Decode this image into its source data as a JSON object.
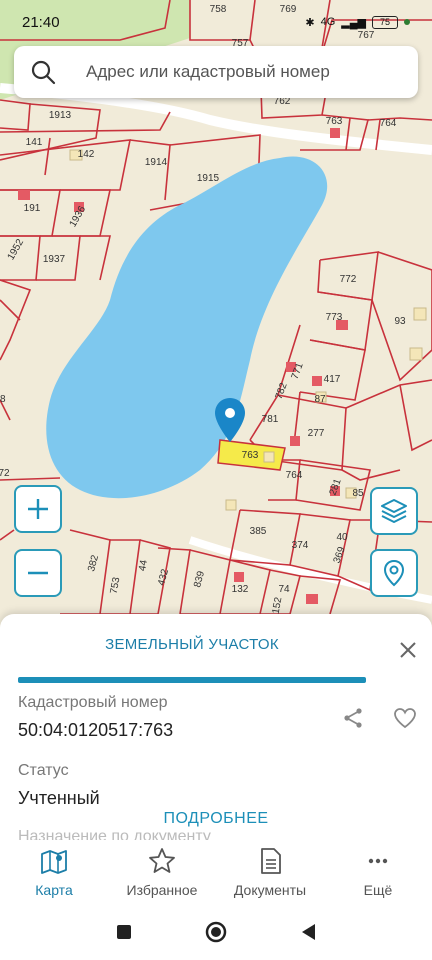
{
  "status_bar": {
    "time": "21:40",
    "network": "4G",
    "battery": "75"
  },
  "search": {
    "placeholder": "Адрес или кадастровый номер"
  },
  "map": {
    "plot_labels": [
      "758",
      "769",
      "757",
      "767",
      "762",
      "763",
      "764",
      "1913",
      "141",
      "142",
      "1914",
      "1915",
      "191",
      "1936",
      "1952",
      "1937",
      "772",
      "773",
      "93",
      "782",
      "771",
      "417",
      "87",
      "781",
      "277",
      "763",
      "764",
      "281",
      "85",
      "385",
      "374",
      "40",
      "369",
      "382",
      "753",
      "44",
      "432",
      "839",
      "132",
      "152",
      "74",
      "68",
      "72"
    ],
    "selected_plot": "763",
    "colors": {
      "parcel_border": "#c8323c",
      "water": "#7ec8ee",
      "selected_fill": "#f5ea4a",
      "accent": "#1c8fb8"
    }
  },
  "controls": {
    "zoom_in_icon": "plus-icon",
    "zoom_out_icon": "minus-icon",
    "layers_icon": "layers-icon",
    "locate_icon": "location-pin-icon"
  },
  "sheet": {
    "title": "ЗЕМЕЛЬНЫЙ УЧАСТОК",
    "cadastral_label": "Кадастровый номер",
    "cadastral_number": "50:04:0120517:763",
    "status_label": "Статус",
    "status_value": "Учтенный",
    "purpose_label": "Назначение по документу",
    "more_button": "ПОДРОБНЕЕ"
  },
  "bottom_nav": [
    {
      "label": "Карта",
      "icon": "map-icon",
      "active": true
    },
    {
      "label": "Избранное",
      "icon": "star-icon",
      "active": false
    },
    {
      "label": "Документы",
      "icon": "document-icon",
      "active": false
    },
    {
      "label": "Ещё",
      "icon": "more-icon",
      "active": false
    }
  ]
}
